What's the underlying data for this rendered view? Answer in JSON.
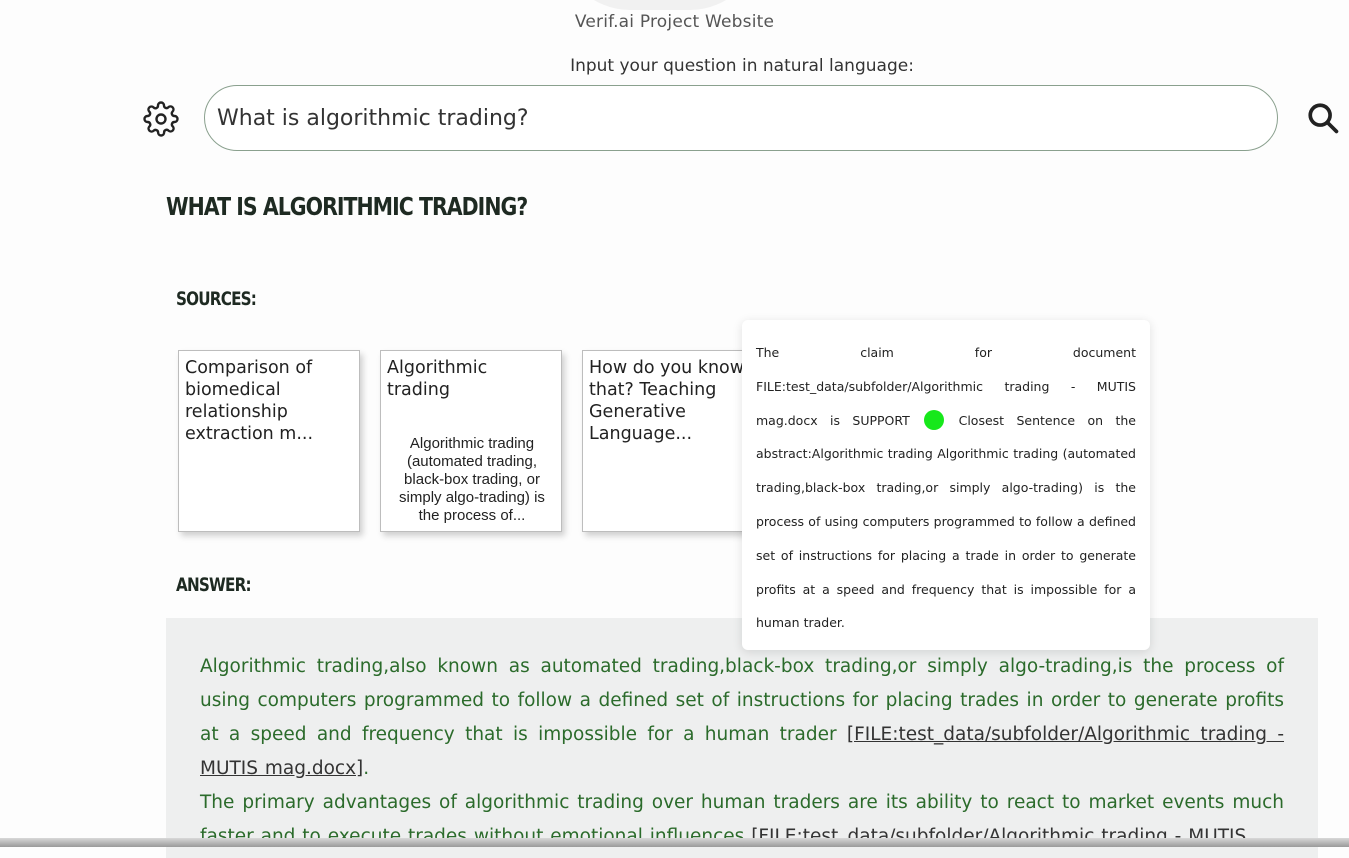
{
  "site_title": "Verif.ai Project Website",
  "prompt_label": "Input your question in natural language:",
  "search": {
    "value": "What is algorithmic trading?"
  },
  "icons": {
    "settings": "gear-icon",
    "search": "search-icon"
  },
  "heading": "What is algorithmic trading?",
  "sources_label": "Sources:",
  "sources": [
    {
      "title": "Comparison of biomedical relationship extraction m...",
      "desc": ""
    },
    {
      "title": "Algorithmic trading",
      "desc": "Algorithmic trading (automated trading, black-box trading, or simply algo-trading) is the process of..."
    },
    {
      "title": "How do you know that? Teaching Generative Language...",
      "desc": ""
    }
  ],
  "tooltip": {
    "before": "The claim for document FILE:test_data/subfolder/Algorithmic trading - MUTIS mag.docx is SUPPORT",
    "status_color": "#17e81b",
    "after": "Closest Sentence on the abstract:Algorithmic trading Algorithmic trading (automated trading,black-box trading,or simply algo-trading) is the process of using computers programmed to follow a defined set of instructions for placing a trade in order to generate profits at a speed and frequency that is impossible for a human trader."
  },
  "answer_label": "Answer:",
  "answer": [
    {
      "text": "Algorithmic trading,also known as automated trading,black-box trading,or simply algo-trading,is the process of using computers programmed to follow a defined set of instructions for placing trades in order to generate profits at a speed and frequency that is impossible for a human trader ",
      "cite": "[FILE:test_data/subfolder/Algorithmic trading - MUTIS mag.docx]",
      "tail": "."
    },
    {
      "text": "The primary advantages of algorithmic trading over human traders are its ability to react to market events much faster and to execute trades without emotional influences ",
      "cite": "[FILE:test_data/subfolder/Algorithmic trading - MUTIS",
      "tail": ""
    }
  ],
  "colors": {
    "answer_text": "#2b6b2b",
    "search_border": "#8aa08e",
    "answer_bg": "#eeefef"
  }
}
